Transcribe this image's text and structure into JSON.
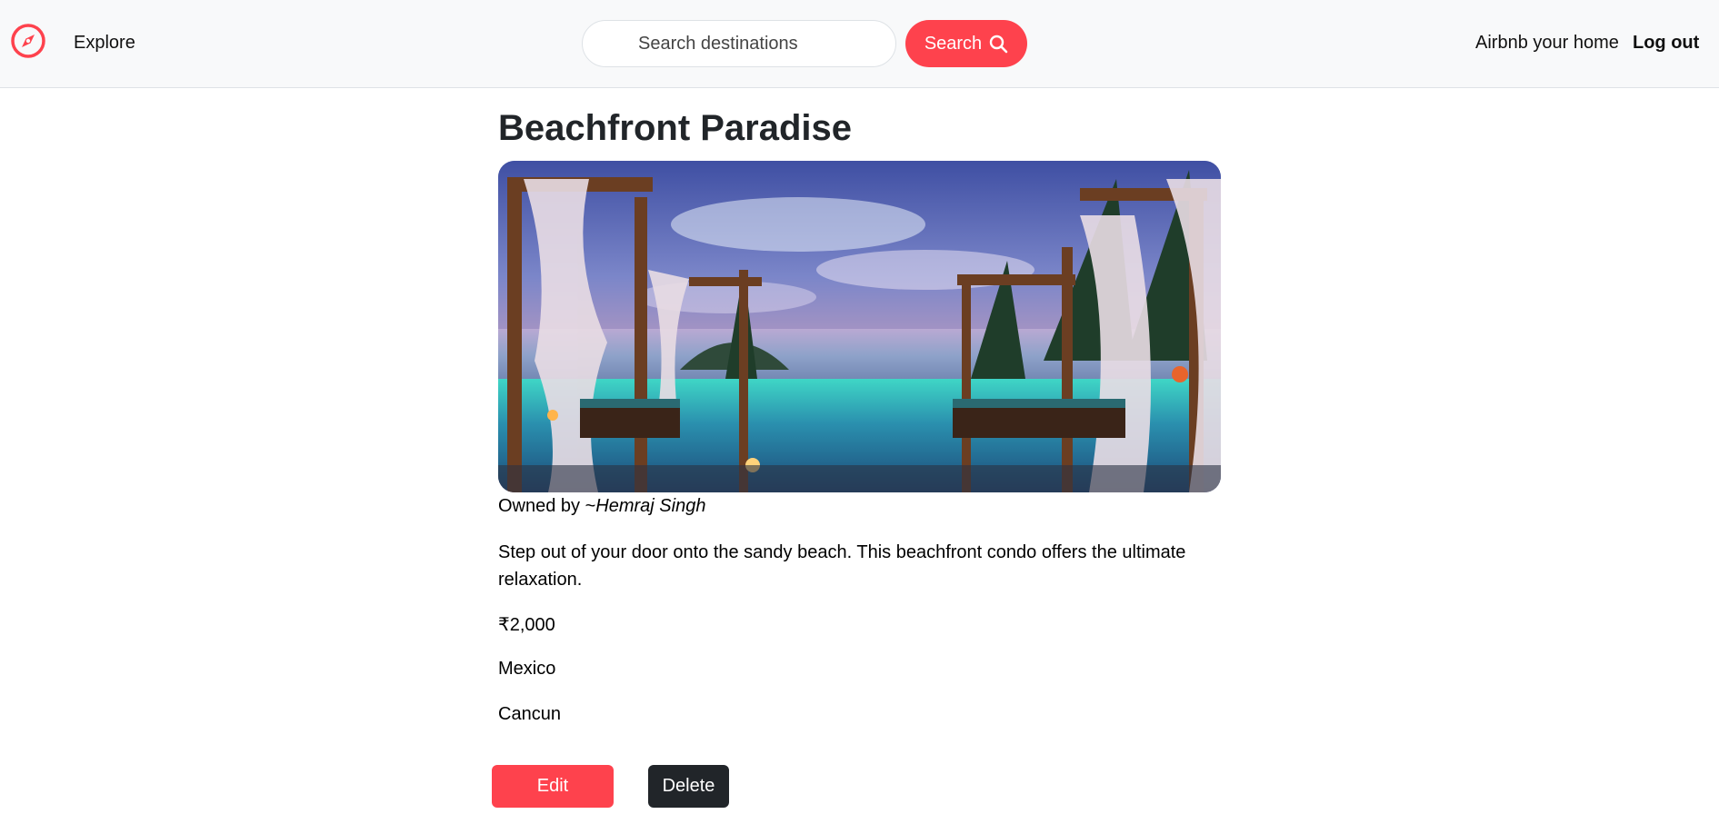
{
  "navbar": {
    "logo_icon": "compass-icon",
    "explore_label": "Explore",
    "search_placeholder": "Search destinations",
    "search_button_label": "Search",
    "search_icon": "search-icon",
    "host_label": "Airbnb your home",
    "logout_label": "Log out"
  },
  "listing": {
    "title": "Beachfront Paradise",
    "image_subject": "beach-resort-photo",
    "owner_prefix": "Owned by ~",
    "owner_name": "Hemraj Singh",
    "description": "Step out of your door onto the sandy beach. This beachfront condo offers the ultimate relaxation.",
    "price": "₹2,000",
    "country": "Mexico",
    "location": "Cancun"
  },
  "actions": {
    "edit_label": "Edit",
    "delete_label": "Delete"
  },
  "colors": {
    "brand": "#fe424d",
    "dark_button": "#212529",
    "navbar_bg": "#f8f9fa"
  }
}
